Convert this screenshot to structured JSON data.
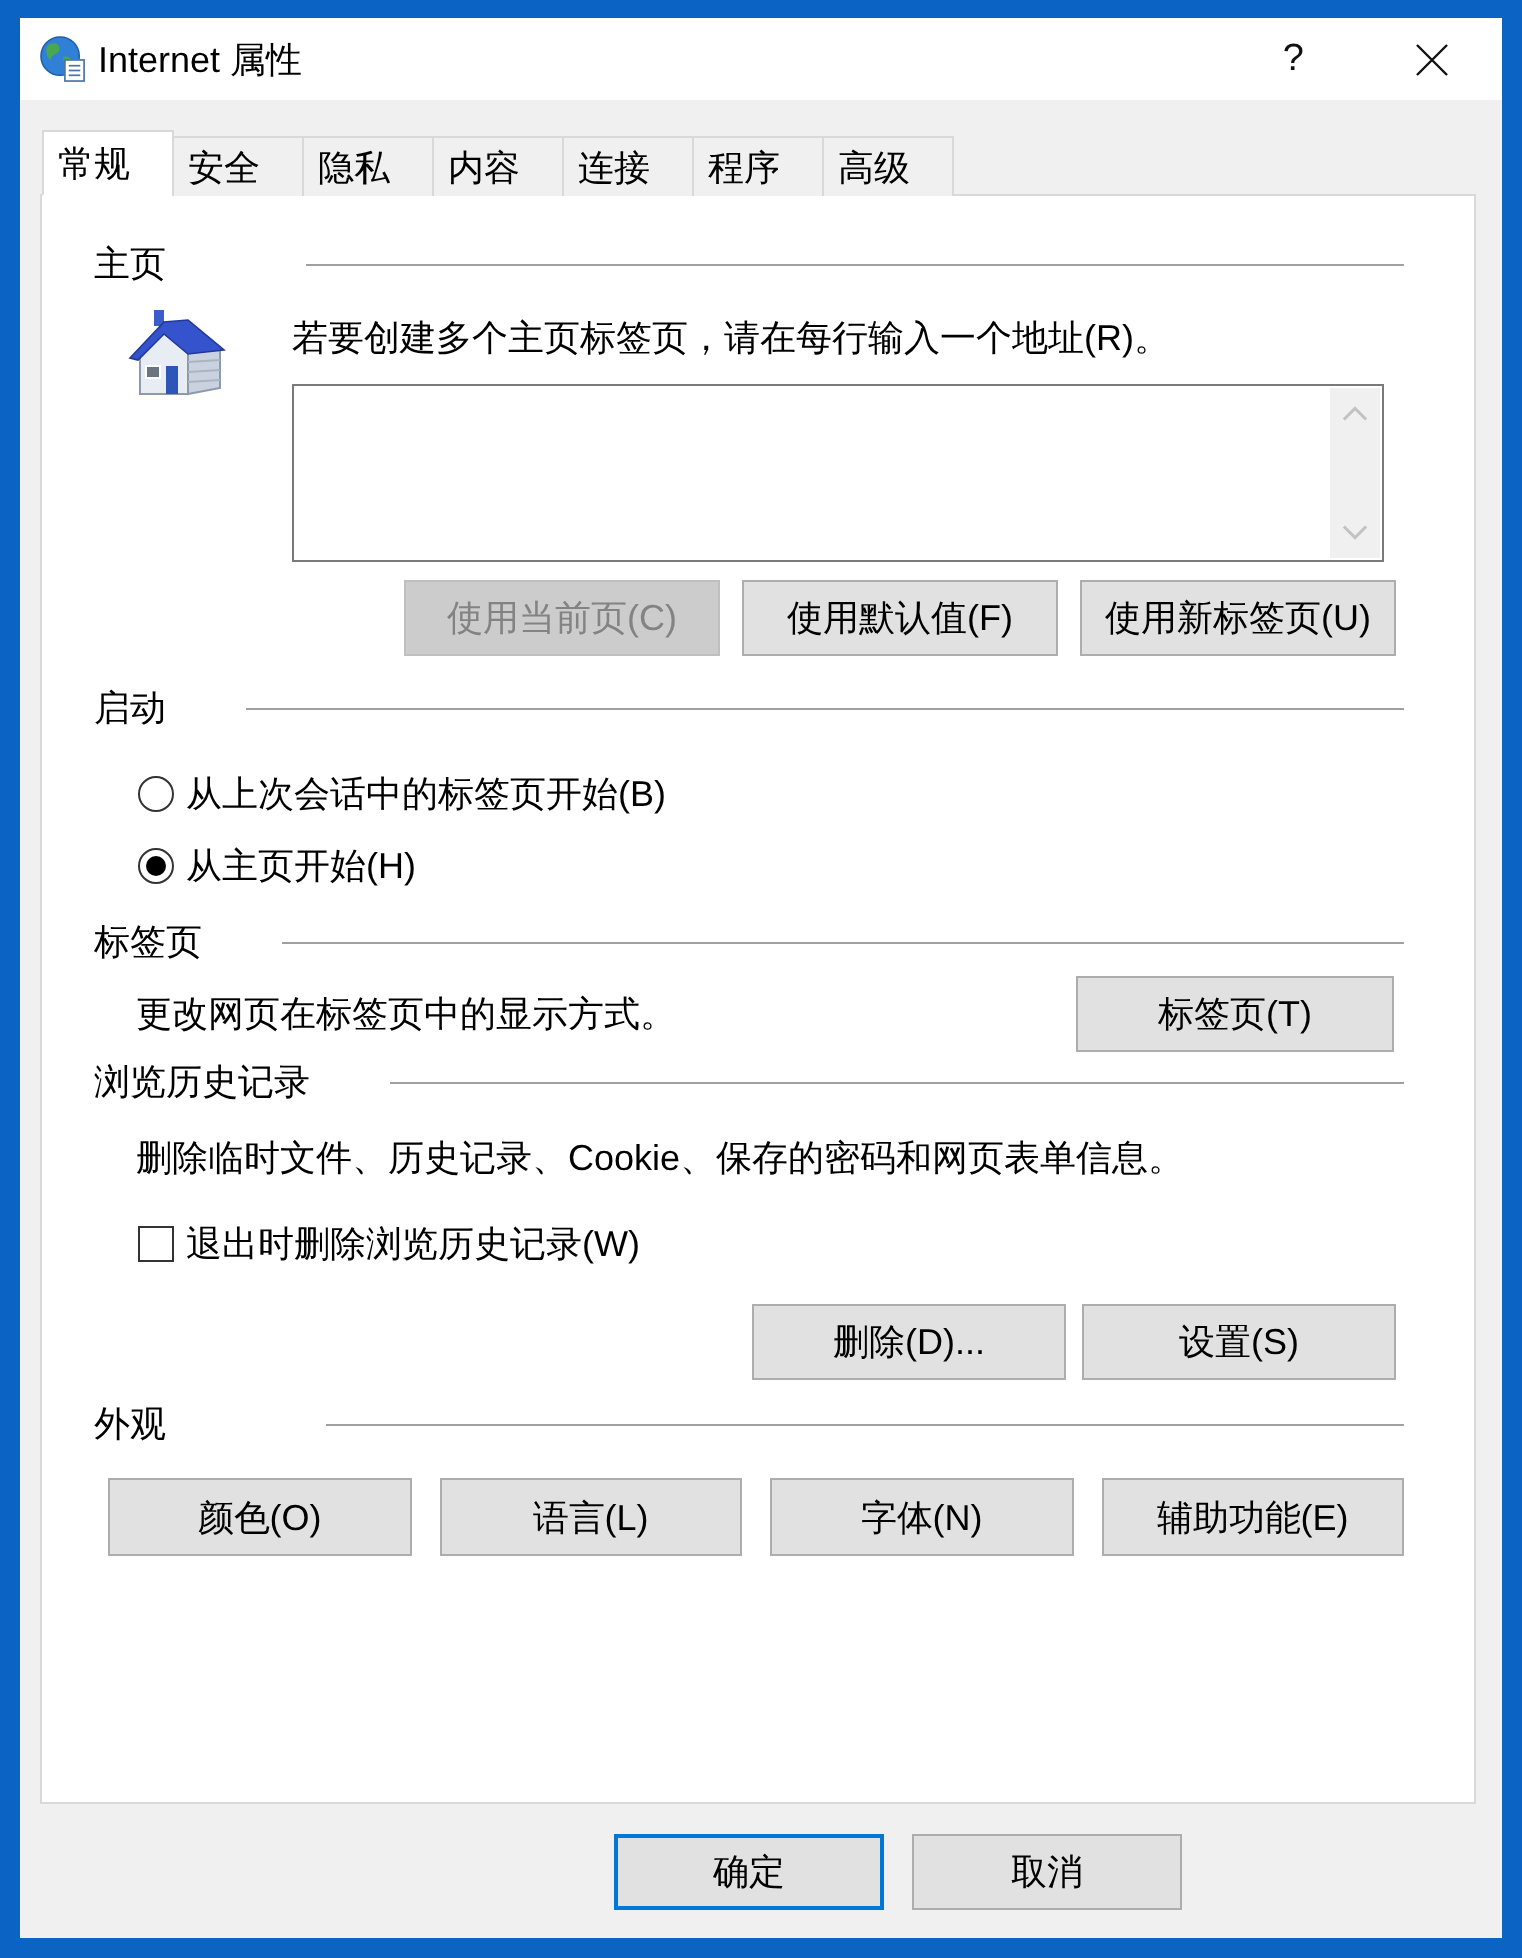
{
  "window": {
    "title": "Internet 属性",
    "help": "?"
  },
  "tabs": [
    {
      "label": "常规",
      "selected": true
    },
    {
      "label": "安全",
      "selected": false
    },
    {
      "label": "隐私",
      "selected": false
    },
    {
      "label": "内容",
      "selected": false
    },
    {
      "label": "连接",
      "selected": false
    },
    {
      "label": "程序",
      "selected": false
    },
    {
      "label": "高级",
      "selected": false
    }
  ],
  "home_page": {
    "heading": "主页",
    "instruction": "若要创建多个主页标签页，请在每行输入一个地址(R)。",
    "buttons": [
      {
        "label": "使用当前页(C)",
        "disabled": true
      },
      {
        "label": "使用默认值(F)",
        "disabled": false
      },
      {
        "label": "使用新标签页(U)",
        "disabled": false
      }
    ]
  },
  "startup": {
    "heading": "启动",
    "options": [
      {
        "label": "从上次会话中的标签页开始(B)",
        "selected": false
      },
      {
        "label": "从主页开始(H)",
        "selected": true
      }
    ]
  },
  "tab_settings": {
    "heading": "标签页",
    "description": "更改网页在标签页中的显示方式。",
    "button": {
      "label": "标签页(T)",
      "disabled": false
    }
  },
  "browsing_history": {
    "heading": "浏览历史记录",
    "description": "删除临时文件、历史记录、Cookie、保存的密码和网页表单信息。",
    "delete_on_exit": {
      "label": "退出时删除浏览历史记录(W)",
      "checked": false
    },
    "buttons": [
      {
        "label": "删除(D)...",
        "disabled": false
      },
      {
        "label": "设置(S)",
        "disabled": false
      }
    ]
  },
  "appearance": {
    "heading": "外观",
    "buttons": [
      {
        "label": "颜色(O)",
        "disabled": false
      },
      {
        "label": "语言(L)",
        "disabled": false
      },
      {
        "label": "字体(N)",
        "disabled": false
      },
      {
        "label": "辅助功能(E)",
        "disabled": false
      }
    ]
  },
  "dialog_buttons": [
    {
      "label": "确定",
      "default": true
    },
    {
      "label": "取消",
      "default": false
    }
  ]
}
